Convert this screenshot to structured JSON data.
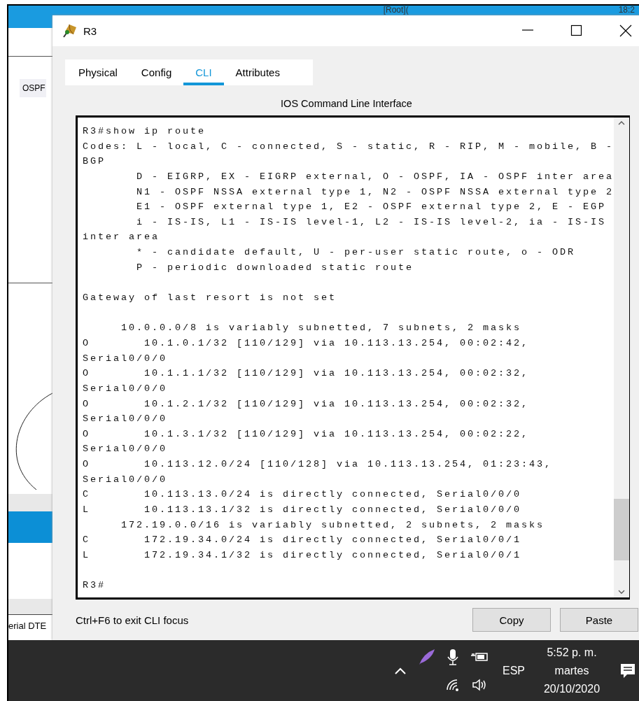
{
  "desktop_bar": {
    "left_text": "[Root](",
    "right_text": "18:2"
  },
  "side_panel": {
    "label": "OSPF",
    "port_label": "erial DTE"
  },
  "window": {
    "title": "R3"
  },
  "tabs": [
    {
      "label": "Physical",
      "selected": false
    },
    {
      "label": "Config",
      "selected": false
    },
    {
      "label": "CLI",
      "selected": true
    },
    {
      "label": "Attributes",
      "selected": false
    }
  ],
  "cli": {
    "heading": "IOS Command Line Interface",
    "paragraphs": [
      [
        "R3#show ip route",
        "Codes: L - local, C - connected, S - static, R - RIP, M - mobile, B -",
        "BGP",
        "       D - EIGRP, EX - EIGRP external, O - OSPF, IA - OSPF inter area",
        "       N1 - OSPF NSSA external type 1, N2 - OSPF NSSA external type 2",
        "       E1 - OSPF external type 1, E2 - OSPF external type 2, E - EGP",
        "       i - IS-IS, L1 - IS-IS level-1, L2 - IS-IS level-2, ia - IS-IS",
        "inter area",
        "       * - candidate default, U - per-user static route, o - ODR",
        "       P - periodic downloaded static route"
      ],
      [
        "Gateway of last resort is not set"
      ],
      [
        "     10.0.0.0/8 is variably subnetted, 7 subnets, 2 masks",
        "O       10.1.0.1/32 [110/129] via 10.113.13.254, 00:02:42,",
        "Serial0/0/0",
        "O       10.1.1.1/32 [110/129] via 10.113.13.254, 00:02:32,",
        "Serial0/0/0",
        "O       10.1.2.1/32 [110/129] via 10.113.13.254, 00:02:32,",
        "Serial0/0/0",
        "O       10.1.3.1/32 [110/129] via 10.113.13.254, 00:02:22,",
        "Serial0/0/0",
        "O       10.113.12.0/24 [110/128] via 10.113.13.254, 01:23:43,",
        "Serial0/0/0",
        "C       10.113.13.0/24 is directly connected, Serial0/0/0",
        "L       10.113.13.1/32 is directly connected, Serial0/0/0",
        "     172.19.0.0/16 is variably subnetted, 2 subnets, 2 masks",
        "C       172.19.34.0/24 is directly connected, Serial0/0/1",
        "L       172.19.34.1/32 is directly connected, Serial0/0/1"
      ],
      [
        "R3#"
      ]
    ],
    "hint": "Ctrl+F6 to exit CLI focus",
    "buttons": [
      "Copy",
      "Paste"
    ]
  },
  "taskbar": {
    "language": "ESP",
    "time": "5:52 p. m.",
    "day": "martes",
    "date": "20/10/2020"
  }
}
